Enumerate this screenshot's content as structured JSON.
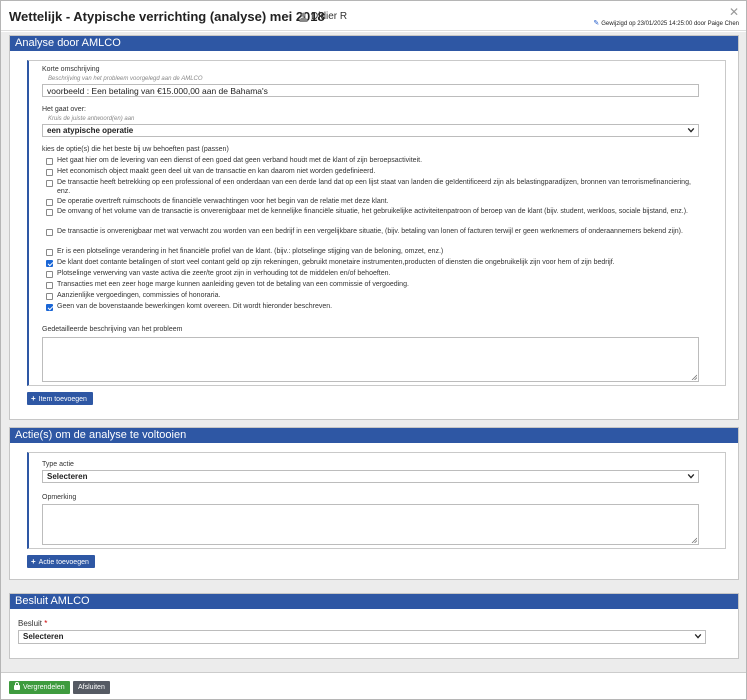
{
  "header": {
    "title": "Wettelijk - Atypische verrichting (analyse) mei 2018",
    "separator": "-",
    "owner": "Didier R",
    "close_icon": "close-icon",
    "edited_text": "Gewijzigd op 23/01/2025 14:25:00 door Paige Chen"
  },
  "analyse": {
    "panel_title": "Analyse door AMLCO",
    "short_desc_label": "Korte omschrijving",
    "short_desc_hint": "Beschrijving van het probleem voorgelegd aan de AMLCO",
    "short_desc_value": "voorbeeld : Een betaling van €15.000,00 aan de Bahama's",
    "concerns_label": "Het gaat over:",
    "concerns_hint": "Kruis de juiste antwoord(en) aan",
    "concerns_value": "een atypische operatie",
    "options_label": "kies de optie(s) die het beste bij uw behoeften past (passen)",
    "options": [
      {
        "text": "Het gaat hier om de levering van een dienst of een goed dat geen verband houdt met de klant of zijn beroepsactiviteit.",
        "checked": false
      },
      {
        "text": "Het economisch object maakt geen deel uit van de transactie en kan daarom niet worden gedefinieerd.",
        "checked": false
      },
      {
        "text": "De transactie heeft betrekking op een professional of een onderdaan van een derde land dat op een lijst staat van landen die geïdentificeerd zijn als belastingparadijzen, bronnen van terrorismefinanciering, enz.",
        "checked": false
      },
      {
        "text": "De operatie overtreft ruimschoots de financiële verwachtingen voor het begin van de relatie met deze klant.",
        "checked": false
      },
      {
        "text": "De omvang of het volume van de transactie is onverenigbaar met de kennelijke financiële situatie, het gebruikelijke activiteitenpatroon of beroep van de klant (bijv. student, werkloos, sociale bijstand, enz.).",
        "checked": false
      },
      {
        "text": "De transactie is onverenigbaar met wat verwacht zou worden van een bedrijf in een vergelijkbare situatie, (bijv. betaling van lonen of facturen terwijl er geen werknemers of onderaannemers bekend zijn).",
        "checked": false
      },
      {
        "text": "Er is een plotselinge verandering in het financiële profiel van de klant. (bijv.: plotselinge stijging van de beloning, omzet, enz.)",
        "checked": false
      },
      {
        "text": "De klant doet contante betalingen of stort veel contant geld op zijn rekeningen, gebruikt monetaire instrumenten,producten of diensten die ongebruikelijk zijn voor hem of zijn bedrijf.",
        "checked": true
      },
      {
        "text": "Plotselinge verwerving van vaste activa die zeer/te groot zijn in verhouding tot de middelen en/of behoeften.",
        "checked": false
      },
      {
        "text": "Transacties met een zeer hoge marge kunnen aanleiding geven tot de betaling van een commissie of vergoeding.",
        "checked": false
      },
      {
        "text": "Aanzienlijke vergoedingen, commissies of honoraria.",
        "checked": false
      },
      {
        "text": "Geen van de bovenstaande bewerkingen komt overeen. Dit wordt hieronder beschreven.",
        "checked": true
      }
    ],
    "detail_label": "Gedetailleerde beschrijving van het probleem",
    "add_item_label": "Item toevoegen"
  },
  "actions": {
    "panel_title": "Actie(s) om de analyse te voltooien",
    "type_label": "Type actie",
    "type_value": "Selecteren",
    "remark_label": "Opmerking",
    "add_action_label": "Actie toevoegen"
  },
  "decision": {
    "panel_title": "Besluit AMLCO",
    "label": "Besluit",
    "required_mark": "*",
    "value": "Selecteren"
  },
  "footer": {
    "lock_label": "Vergrendelen",
    "close_label": "Afsluiten"
  },
  "colors": {
    "accent": "#2e57a4",
    "lock_button": "#3e9b3e",
    "close_button": "#555a63",
    "checkbox_checked": "#1a66d6"
  }
}
